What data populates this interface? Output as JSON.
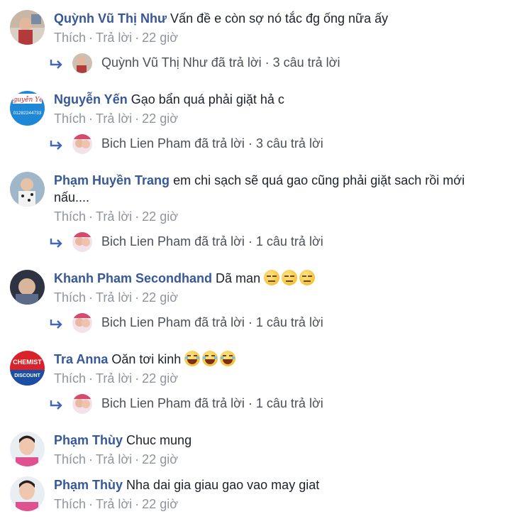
{
  "actions": {
    "like": "Thích",
    "reply": "Trả lời",
    "separator": "·"
  },
  "comments": [
    {
      "author": "Quỳnh Vũ Thị Như",
      "text": "Vấn đề e còn sợ nó tắc đg ống nữa ấy",
      "time": "22 giờ",
      "reply_summary": "Quỳnh Vũ Thị Như đã trả lời · 3 câu trả lời"
    },
    {
      "author": "Nguyễn Yến",
      "text": "Gạo bẩn quá phải giặt hả c",
      "time": "22 giờ",
      "reply_summary": "Bich Lien Pham đã trả lời · 3 câu trả lời",
      "avatar_text": "Nguyễn Yến",
      "avatar_text2": "01282244733"
    },
    {
      "author": "Phạm Huyền Trang",
      "text": "em chi sạch sẽ quá gao cũng phải giặt sach rồi mới",
      "text_cont": "nấu....",
      "time": "22 giờ",
      "reply_summary": "Bich Lien Pham đã trả lời · 1 câu trả lời"
    },
    {
      "author": "Khanh Pham Secondhand",
      "text": "Dã man",
      "time": "22 giờ",
      "reply_summary": "Bich Lien Pham đã trả lời · 1 câu trả lời"
    },
    {
      "author": "Tra Anna",
      "text": "Oăn tơi kinh",
      "time": "22 giờ",
      "reply_summary": "Bich Lien Pham đã trả lời · 1 câu trả lời",
      "avatar_text": "CHEMIST",
      "avatar_text2": "DISCOUNT"
    },
    {
      "author": "Phạm Thùy",
      "text": "Chuc mung",
      "time": "22 giờ"
    },
    {
      "author": "Phạm Thùy",
      "text": "Nha dai gia giau gao vao may giat",
      "time": "22 giờ"
    }
  ],
  "colors": {
    "author": "#365899",
    "meta": "#90949c",
    "reply_link": "#4b4f56"
  },
  "icons": {
    "reply_arrow": "reply-arrow-icon",
    "meh_emoji": "expressionless-face-icon",
    "laugh_emoji": "tears-of-joy-icon"
  }
}
